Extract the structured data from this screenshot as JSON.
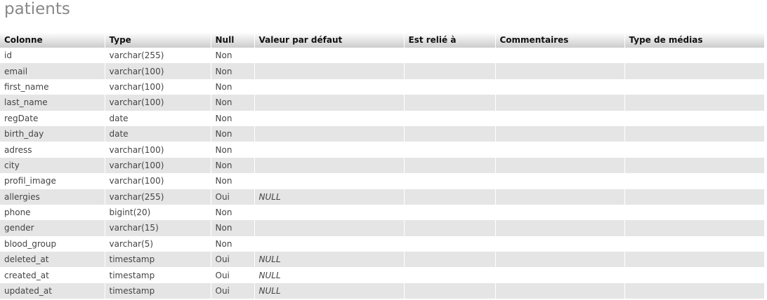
{
  "title": "patients",
  "headers": [
    "Colonne",
    "Type",
    "Null",
    "Valeur par défaut",
    "Est relié à",
    "Commentaires",
    "Type de médias"
  ],
  "rows": [
    {
      "column": "id",
      "type": "varchar(255)",
      "null": "Non",
      "default": "",
      "links_to": "",
      "comments": "",
      "media_type": ""
    },
    {
      "column": "email",
      "type": "varchar(100)",
      "null": "Non",
      "default": "",
      "links_to": "",
      "comments": "",
      "media_type": ""
    },
    {
      "column": "first_name",
      "type": "varchar(100)",
      "null": "Non",
      "default": "",
      "links_to": "",
      "comments": "",
      "media_type": ""
    },
    {
      "column": "last_name",
      "type": "varchar(100)",
      "null": "Non",
      "default": "",
      "links_to": "",
      "comments": "",
      "media_type": ""
    },
    {
      "column": "regDate",
      "type": "date",
      "null": "Non",
      "default": "",
      "links_to": "",
      "comments": "",
      "media_type": ""
    },
    {
      "column": "birth_day",
      "type": "date",
      "null": "Non",
      "default": "",
      "links_to": "",
      "comments": "",
      "media_type": ""
    },
    {
      "column": "adress",
      "type": "varchar(100)",
      "null": "Non",
      "default": "",
      "links_to": "",
      "comments": "",
      "media_type": ""
    },
    {
      "column": "city",
      "type": "varchar(100)",
      "null": "Non",
      "default": "",
      "links_to": "",
      "comments": "",
      "media_type": ""
    },
    {
      "column": "profil_image",
      "type": "varchar(100)",
      "null": "Non",
      "default": "",
      "links_to": "",
      "comments": "",
      "media_type": ""
    },
    {
      "column": "allergies",
      "type": "varchar(255)",
      "null": "Oui",
      "default": "NULL",
      "links_to": "",
      "comments": "",
      "media_type": ""
    },
    {
      "column": "phone",
      "type": "bigint(20)",
      "null": "Non",
      "default": "",
      "links_to": "",
      "comments": "",
      "media_type": ""
    },
    {
      "column": "gender",
      "type": "varchar(15)",
      "null": "Non",
      "default": "",
      "links_to": "",
      "comments": "",
      "media_type": ""
    },
    {
      "column": "blood_group",
      "type": "varchar(5)",
      "null": "Non",
      "default": "",
      "links_to": "",
      "comments": "",
      "media_type": ""
    },
    {
      "column": "deleted_at",
      "type": "timestamp",
      "null": "Oui",
      "default": "NULL",
      "links_to": "",
      "comments": "",
      "media_type": ""
    },
    {
      "column": "created_at",
      "type": "timestamp",
      "null": "Oui",
      "default": "NULL",
      "links_to": "",
      "comments": "",
      "media_type": ""
    },
    {
      "column": "updated_at",
      "type": "timestamp",
      "null": "Oui",
      "default": "NULL",
      "links_to": "",
      "comments": "",
      "media_type": ""
    }
  ]
}
